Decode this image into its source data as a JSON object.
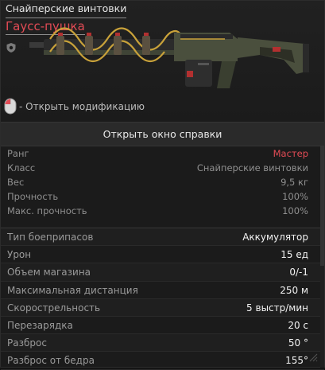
{
  "header": {
    "category": "Снайперские винтовки",
    "name": "Гаусс-пушка",
    "hint_text": "- Открыть модификацию"
  },
  "help_button": {
    "label": "Открыть окно справки"
  },
  "basic_stats": [
    {
      "label": "Ранг",
      "value": "Мастер",
      "accent": true
    },
    {
      "label": "Класс",
      "value": "Снайперские винтовки"
    },
    {
      "label": "Вес",
      "value": "9,5 кг"
    },
    {
      "label": "Прочность",
      "value": "100%"
    },
    {
      "label": "Макс. прочность",
      "value": "100%"
    }
  ],
  "weapon_stats": [
    {
      "label": "Тип боеприпасов",
      "value": "Аккумулятор"
    },
    {
      "label": "Урон",
      "value": "15 ед"
    },
    {
      "label": "Объем магазина",
      "value": "0/-1"
    },
    {
      "label": "Максимальная дистанция",
      "value": "250 м"
    },
    {
      "label": "Скорострельность",
      "value": "5 выстр/мин"
    },
    {
      "label": "Перезарядка",
      "value": "20 с"
    },
    {
      "label": "Разброс",
      "value": "50 °"
    },
    {
      "label": "Разброс от бедра",
      "value": "155°"
    }
  ],
  "colors": {
    "accent": "#e24b55",
    "background": "#1b1b1b",
    "coil": "#c9a23a",
    "weapon_body": "#4a4f3d"
  },
  "icons": [
    "shield-icon",
    "mouse-icon",
    "gauss-cannon-image",
    "resize-corner-icon"
  ]
}
